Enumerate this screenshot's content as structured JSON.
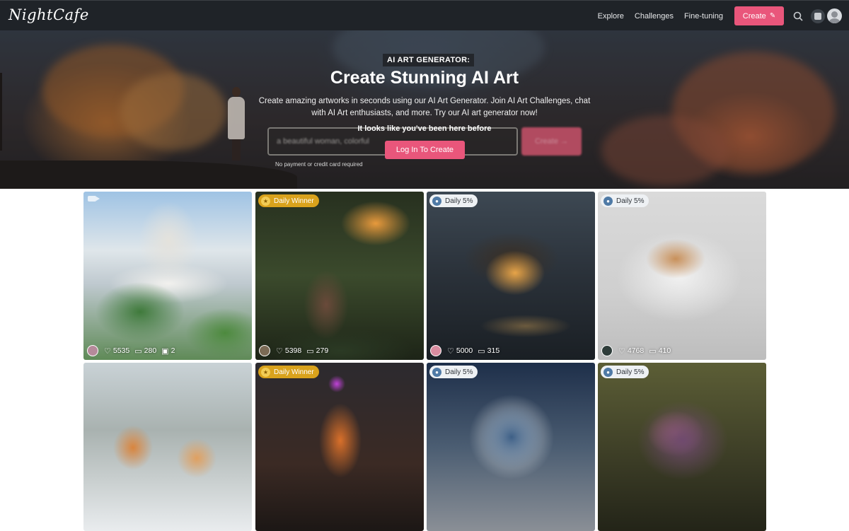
{
  "nav": {
    "logo": "NightCafe",
    "links": [
      "Explore",
      "Challenges",
      "Fine-tuning"
    ],
    "create_label": "Create",
    "icons": [
      "search-icon",
      "dice-icon",
      "user-avatar"
    ]
  },
  "hero": {
    "tag": "AI ART GENERATOR:",
    "title": "Create Stunning AI Art",
    "description": "Create amazing artworks in seconds using our AI Art Generator. Join AI Art Challenges, chat with AI Art enthusiasts, and more. Try our AI art generator now!",
    "prompt_placeholder": "a beautiful woman, colorful",
    "prompt_create_label": "Create →",
    "returning_notice": "It looks like you've been here before",
    "login_label": "Log In To Create",
    "no_payment_note": "No payment or credit card required"
  },
  "colors": {
    "accent": "#e9567b",
    "nav_bg": "#1f2328",
    "winner_badge": "#d9a21c"
  },
  "gallery": [
    {
      "badge": "",
      "video": true,
      "likes": "5535",
      "comments": "280",
      "images": "2"
    },
    {
      "badge": "Daily Winner",
      "likes": "5398",
      "comments": "279"
    },
    {
      "badge": "Daily 5%",
      "likes": "5000",
      "comments": "315"
    },
    {
      "badge": "Daily 5%",
      "likes": "4768",
      "comments": "410"
    },
    {
      "badge": ""
    },
    {
      "badge": "Daily Winner"
    },
    {
      "badge": "Daily 5%"
    },
    {
      "badge": "Daily 5%"
    }
  ]
}
